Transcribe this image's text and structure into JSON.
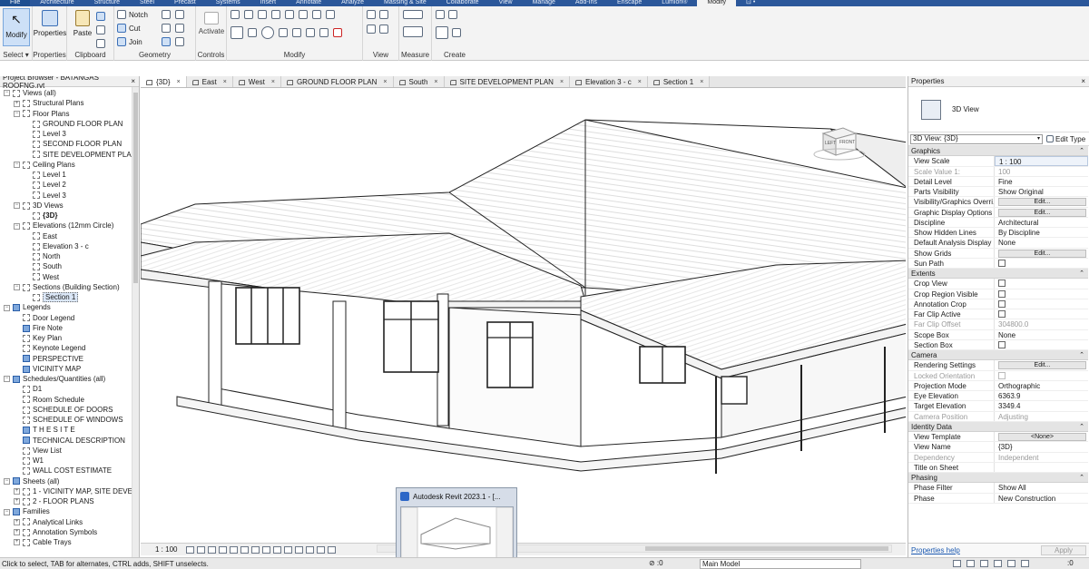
{
  "ribbon_tabs": [
    "File",
    "Architecture",
    "Structure",
    "Steel",
    "Precast",
    "Systems",
    "Insert",
    "Annotate",
    "Analyze",
    "Massing & Site",
    "Collaborate",
    "View",
    "Manage",
    "Add-Ins",
    "Enscape",
    "Lumion®",
    "Modify",
    "⊡ •"
  ],
  "ribbon": {
    "modify_label": "Modify",
    "properties_label": "Properties",
    "paste_label": "Paste",
    "notch_label": "Notch",
    "cut_label": "Cut",
    "join_label": "Join",
    "activate_label": "Activate",
    "groups": {
      "select": "Select",
      "select_arrow": "▾",
      "properties": "Properties",
      "clipboard": "Clipboard",
      "geometry": "Geometry",
      "controls": "Controls",
      "modify": "Modify",
      "view": "View",
      "measure": "Measure",
      "create": "Create"
    }
  },
  "project_browser": {
    "title": "Project Browser - BATANGAS ROOFNG.rvt",
    "close": "×",
    "tree": [
      {
        "label": "Views (all)",
        "depth": 0,
        "type": "root",
        "exp": "−"
      },
      {
        "label": "Structural Plans",
        "depth": 1,
        "type": "folder",
        "exp": "+"
      },
      {
        "label": "Floor Plans",
        "depth": 1,
        "type": "folder",
        "exp": "−"
      },
      {
        "label": "GROUND FLOOR PLAN",
        "depth": 2,
        "type": "view"
      },
      {
        "label": "Level 3",
        "depth": 2,
        "type": "view"
      },
      {
        "label": "SECOND FLOOR PLAN",
        "depth": 2,
        "type": "view"
      },
      {
        "label": "SITE DEVELOPMENT PLAN",
        "depth": 2,
        "type": "view"
      },
      {
        "label": "Ceiling Plans",
        "depth": 1,
        "type": "folder",
        "exp": "−"
      },
      {
        "label": "Level 1",
        "depth": 2,
        "type": "view"
      },
      {
        "label": "Level 2",
        "depth": 2,
        "type": "view"
      },
      {
        "label": "Level 3",
        "depth": 2,
        "type": "view"
      },
      {
        "label": "3D Views",
        "depth": 1,
        "type": "folder",
        "exp": "−"
      },
      {
        "label": "{3D}",
        "depth": 2,
        "type": "view",
        "bold": true
      },
      {
        "label": "Elevations (12mm Circle)",
        "depth": 1,
        "type": "folder",
        "exp": "−"
      },
      {
        "label": "East",
        "depth": 2,
        "type": "view"
      },
      {
        "label": "Elevation 3 - c",
        "depth": 2,
        "type": "view"
      },
      {
        "label": "North",
        "depth": 2,
        "type": "view"
      },
      {
        "label": "South",
        "depth": 2,
        "type": "view"
      },
      {
        "label": "West",
        "depth": 2,
        "type": "view"
      },
      {
        "label": "Sections (Building Section)",
        "depth": 1,
        "type": "folder",
        "exp": "−"
      },
      {
        "label": "Section 1",
        "depth": 2,
        "type": "view",
        "selected": true
      },
      {
        "label": "Legends",
        "depth": 0,
        "type": "legend-root",
        "exp": "−"
      },
      {
        "label": "Door Legend",
        "depth": 1,
        "type": "view"
      },
      {
        "label": "Fire Note",
        "depth": 1,
        "type": "legend"
      },
      {
        "label": "Key Plan",
        "depth": 1,
        "type": "view"
      },
      {
        "label": "Keynote Legend",
        "depth": 1,
        "type": "view"
      },
      {
        "label": "PERSPECTIVE",
        "depth": 1,
        "type": "legend"
      },
      {
        "label": "VICINITY MAP",
        "depth": 1,
        "type": "legend"
      },
      {
        "label": "Schedules/Quantities (all)",
        "depth": 0,
        "type": "sched-root",
        "exp": "−"
      },
      {
        "label": "D1",
        "depth": 1,
        "type": "view"
      },
      {
        "label": "Room Schedule",
        "depth": 1,
        "type": "view"
      },
      {
        "label": "SCHEDULE OF DOORS",
        "depth": 1,
        "type": "view"
      },
      {
        "label": "SCHEDULE OF WINDOWS",
        "depth": 1,
        "type": "view"
      },
      {
        "label": "T H E  S I T E",
        "depth": 1,
        "type": "legend"
      },
      {
        "label": "TECHNICAL DESCRIPTION",
        "depth": 1,
        "type": "legend"
      },
      {
        "label": "View List",
        "depth": 1,
        "type": "view"
      },
      {
        "label": "W1",
        "depth": 1,
        "type": "view"
      },
      {
        "label": "WALL COST ESTIMATE",
        "depth": 1,
        "type": "view"
      },
      {
        "label": "Sheets (all)",
        "depth": 0,
        "type": "sheet-root",
        "exp": "−"
      },
      {
        "label": "1 - VICINITY MAP, SITE DEVELOPM",
        "depth": 1,
        "type": "sheet",
        "exp": "+"
      },
      {
        "label": "2 - FLOOR PLANS",
        "depth": 1,
        "type": "sheet",
        "exp": "+"
      },
      {
        "label": "Families",
        "depth": 0,
        "type": "fam-root",
        "exp": "−"
      },
      {
        "label": "Analytical Links",
        "depth": 1,
        "type": "folder",
        "exp": "+"
      },
      {
        "label": "Annotation Symbols",
        "depth": 1,
        "type": "folder",
        "exp": "+"
      },
      {
        "label": "Cable Trays",
        "depth": 1,
        "type": "folder",
        "exp": "+"
      }
    ]
  },
  "view_tabs": [
    {
      "label": "{3D}",
      "active": true
    },
    {
      "label": "East"
    },
    {
      "label": "West"
    },
    {
      "label": "GROUND FLOOR PLAN"
    },
    {
      "label": "South"
    },
    {
      "label": "SITE DEVELOPMENT PLAN"
    },
    {
      "label": "Elevation 3 - c"
    },
    {
      "label": "Section 1"
    }
  ],
  "view_tab_close": "×",
  "viewcube": {
    "left": "LEFT",
    "front": "FRONT"
  },
  "view_control_bar": {
    "scale": "1 : 100"
  },
  "properties": {
    "title": "Properties",
    "close": "×",
    "type_name": "3D View",
    "selector": "3D View: {3D}",
    "selector_arrow": "▾",
    "edit_type": "Edit Type",
    "collapse_glyph": "⌃",
    "sections": [
      {
        "name": "Graphics",
        "rows": [
          {
            "k": "View Scale",
            "v": "1 : 100",
            "hl": true
          },
          {
            "k": "Scale Value    1:",
            "v": "100",
            "dis": true
          },
          {
            "k": "Detail Level",
            "v": "Fine"
          },
          {
            "k": "Parts Visibility",
            "v": "Show Original"
          },
          {
            "k": "Visibility/Graphics Overri...",
            "v": "Edit...",
            "btn": true
          },
          {
            "k": "Graphic Display Options",
            "v": "Edit...",
            "btn": true
          },
          {
            "k": "Discipline",
            "v": "Architectural"
          },
          {
            "k": "Show Hidden Lines",
            "v": "By Discipline"
          },
          {
            "k": "Default Analysis Display S...",
            "v": "None"
          },
          {
            "k": "Show Grids",
            "v": "Edit...",
            "btn": true
          },
          {
            "k": "Sun Path",
            "v": "",
            "cb": true
          }
        ]
      },
      {
        "name": "Extents",
        "rows": [
          {
            "k": "Crop View",
            "v": "",
            "cb": true
          },
          {
            "k": "Crop Region Visible",
            "v": "",
            "cb": true
          },
          {
            "k": "Annotation Crop",
            "v": "",
            "cb": true
          },
          {
            "k": "Far Clip Active",
            "v": "",
            "cb": true
          },
          {
            "k": "Far Clip Offset",
            "v": "304800.0",
            "dis": true
          },
          {
            "k": "Scope Box",
            "v": "None"
          },
          {
            "k": "Section Box",
            "v": "",
            "cb": true
          }
        ]
      },
      {
        "name": "Camera",
        "rows": [
          {
            "k": "Rendering Settings",
            "v": "Edit...",
            "btn": true
          },
          {
            "k": "Locked Orientation",
            "v": "",
            "cb": true,
            "dis": true
          },
          {
            "k": "Projection Mode",
            "v": "Orthographic"
          },
          {
            "k": "Eye Elevation",
            "v": "6363.9"
          },
          {
            "k": "Target Elevation",
            "v": "3349.4"
          },
          {
            "k": "Camera Position",
            "v": "Adjusting",
            "dis": true
          }
        ]
      },
      {
        "name": "Identity Data",
        "rows": [
          {
            "k": "View Template",
            "v": "<None>",
            "btn": true
          },
          {
            "k": "View Name",
            "v": "{3D}"
          },
          {
            "k": "Dependency",
            "v": "Independent",
            "dis": true
          },
          {
            "k": "Title on Sheet",
            "v": ""
          }
        ]
      },
      {
        "name": "Phasing",
        "rows": [
          {
            "k": "Phase Filter",
            "v": "Show All"
          },
          {
            "k": "Phase",
            "v": "New Construction"
          }
        ]
      }
    ],
    "help_link": "Properties help",
    "apply": "Apply"
  },
  "status_bar": {
    "message": "Click to select, TAB for alternates, CTRL adds, SHIFT unselects.",
    "zero": "⊘ :0",
    "model": "Main Model",
    "filter_count": ":0"
  },
  "taskbar_preview": {
    "title": "Autodesk Revit 2023.1 - [..."
  }
}
